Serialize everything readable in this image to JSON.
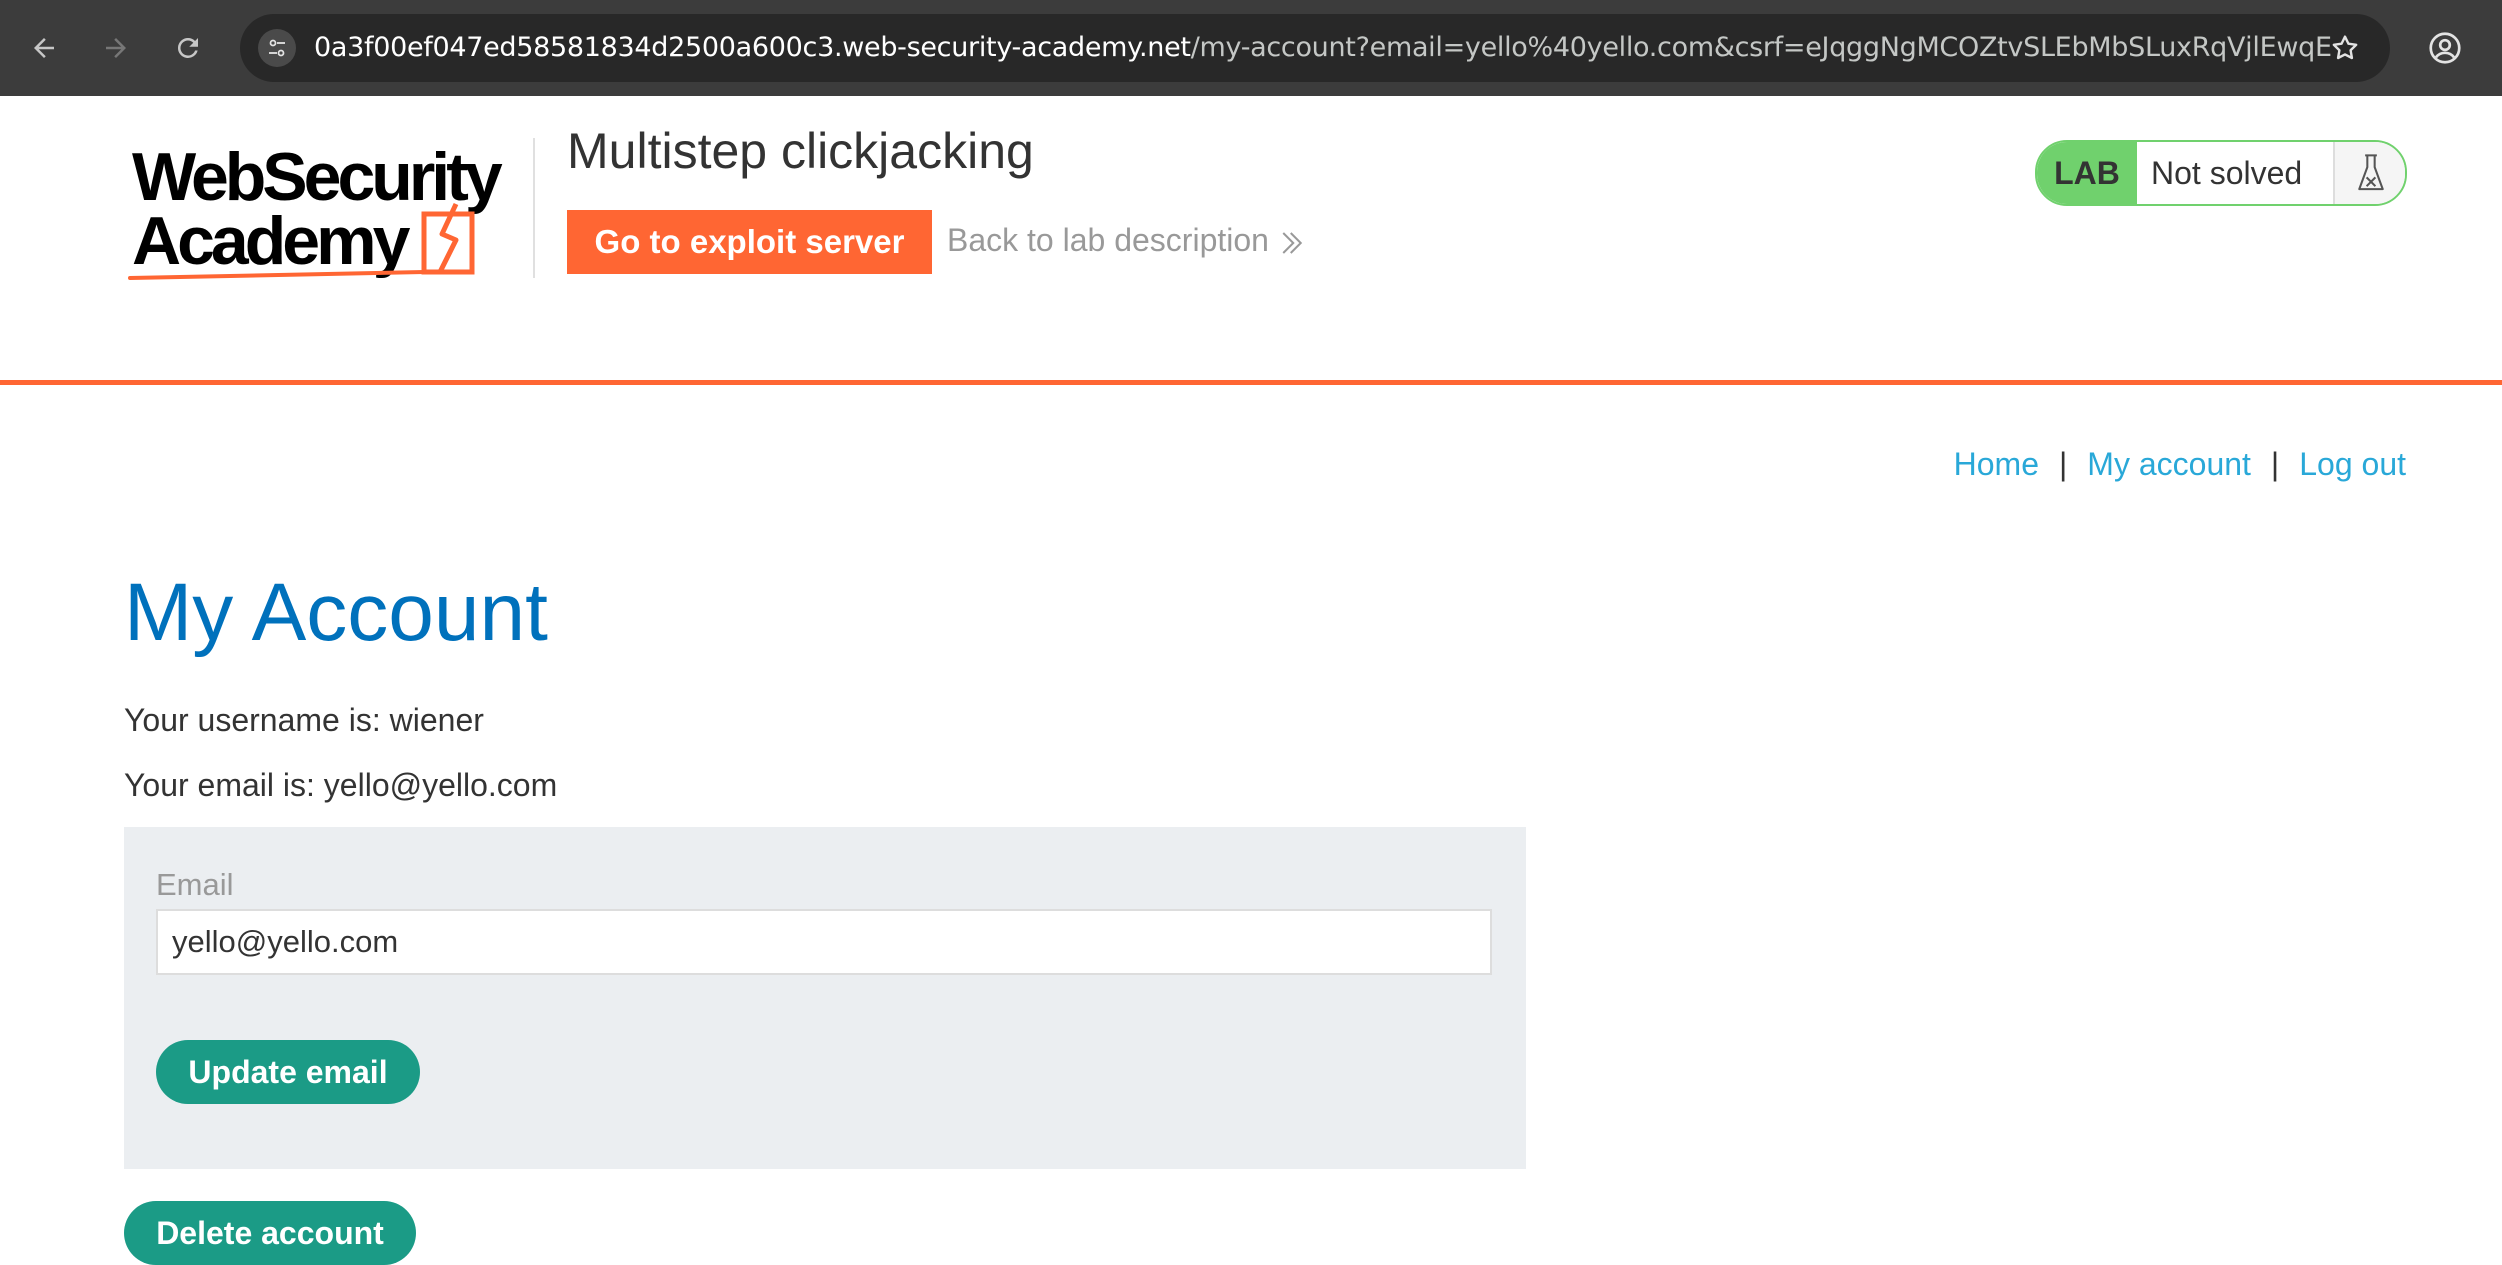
{
  "browser": {
    "url_host": "0a3f00ef047ed58581834d2500a600c3.web-security-academy.net",
    "url_rest": "/my-account?email=yello%40yello.com&csrf=eJqggNgMCOZtvSLEbMbSLuxRqVjlEwqE",
    "icons": {
      "back": "arrow-left-icon",
      "forward": "arrow-right-icon",
      "reload": "reload-icon",
      "site_info": "tune-icon",
      "bookmark": "star-icon",
      "profile": "account-circle-icon"
    }
  },
  "lab_header": {
    "logo_line1": "WebSecurity",
    "logo_line2": "Academy",
    "title": "Multistep clickjacking",
    "exploit_button": "Go to exploit server",
    "back_link": "Back to lab description",
    "status_badge": "LAB",
    "status_text": "Not solved",
    "colors": {
      "accent": "#ff6633",
      "lab_green": "#70d16d"
    }
  },
  "nav": {
    "home": "Home",
    "my_account": "My account",
    "log_out": "Log out",
    "separator": "|"
  },
  "account": {
    "title": "My Account",
    "username_line": "Your username is: wiener",
    "email_line": "Your email is: yello@yello.com",
    "email_label": "Email",
    "email_value": "yello@yello.com",
    "update_button": "Update email",
    "delete_button": "Delete account",
    "colors": {
      "heading": "#0071bc",
      "link": "#29a8d8",
      "button": "#1b9b86"
    }
  }
}
